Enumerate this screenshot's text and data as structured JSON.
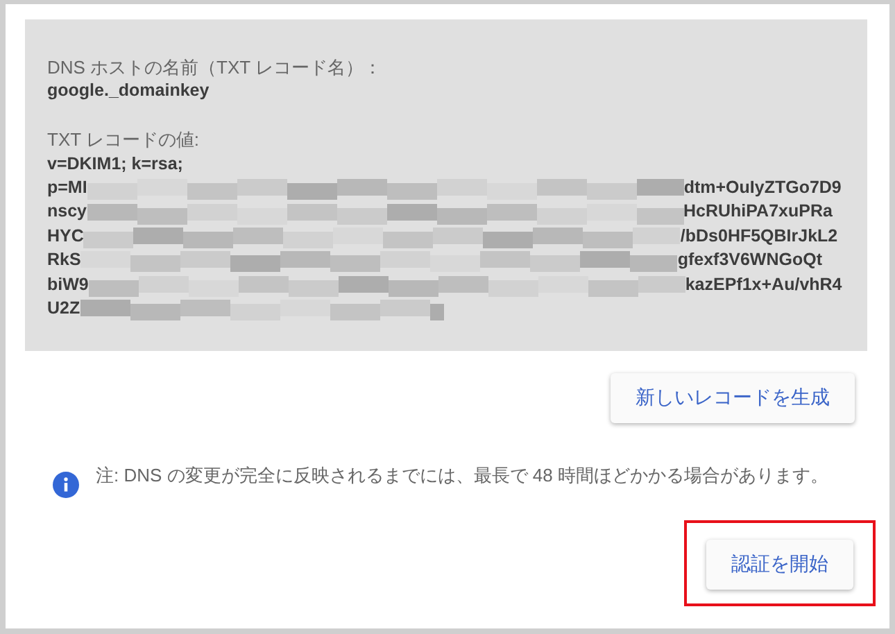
{
  "dns_record": {
    "host_label": "DNS ホストの名前（TXT レコード名）：",
    "host_value": "google._domainkey",
    "value_label": "TXT レコードの値:",
    "value_lines": [
      {
        "start": "v=DKIM1; k=rsa;",
        "blurred": false
      },
      {
        "start": "p=MI",
        "blurred": true,
        "end": "dtm+OuIyZTGo7D9"
      },
      {
        "start": "nscy",
        "blurred": true,
        "end": "HcRUhiPA7xuPRa"
      },
      {
        "start": "HYC",
        "blurred": true,
        "end": "/bDs0HF5QBIrJkL2"
      },
      {
        "start": "RkS",
        "blurred": true,
        "end": "gfexf3V6WNGoQt"
      },
      {
        "start": "biW9",
        "blurred": true,
        "end": "kazEPf1x+Au/vhR4"
      },
      {
        "start": "U2Z",
        "blurred": true
      }
    ]
  },
  "generate_button": "新しいレコードを生成",
  "note": "注: DNS の変更が完全に反映されるまでには、最長で 48 時間ほどかかる場合があります。",
  "start_button": {
    "label": "認証を開始",
    "highlighted": true
  }
}
